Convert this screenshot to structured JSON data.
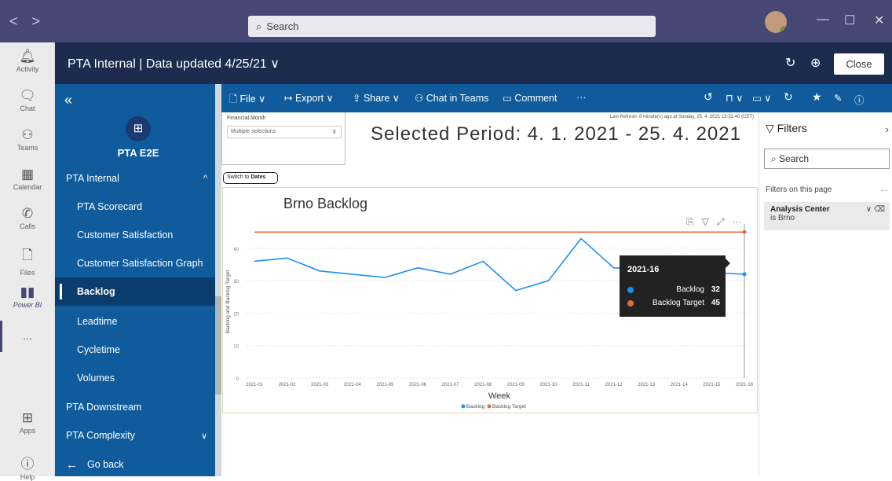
{
  "titlebar": {
    "search_placeholder": "Search",
    "back": "<",
    "forward": ">"
  },
  "rail": [
    {
      "label": "Activity",
      "icon": "bell-icon",
      "glyph": "🔔"
    },
    {
      "label": "Chat",
      "icon": "chat-icon",
      "glyph": "💬"
    },
    {
      "label": "Teams",
      "icon": "teams-icon",
      "glyph": "👥"
    },
    {
      "label": "Calendar",
      "icon": "calendar-icon",
      "glyph": "📅"
    },
    {
      "label": "Calls",
      "icon": "phone-icon",
      "glyph": "📞"
    },
    {
      "label": "Files",
      "icon": "file-icon",
      "glyph": "🗋"
    },
    {
      "label": "Power BI",
      "icon": "powerbi-icon",
      "glyph": "📊"
    },
    {
      "label": "...",
      "icon": "more-icon",
      "glyph": ""
    },
    {
      "label": "Apps",
      "icon": "apps-icon",
      "glyph": "⊞"
    },
    {
      "label": "Help",
      "icon": "help-icon",
      "glyph": "?"
    }
  ],
  "appbar": {
    "title": "PTA Internal | Data updated 4/25/21 ∨",
    "close_label": "Close"
  },
  "leftnav": {
    "workspace": "PTA E2E",
    "items": [
      {
        "label": "PTA Internal",
        "type": "section",
        "chev": "^"
      },
      {
        "label": "PTA Scorecard",
        "type": "sub"
      },
      {
        "label": "Customer Satisfaction",
        "type": "sub"
      },
      {
        "label": "Customer Satisfaction Graph",
        "type": "sub"
      },
      {
        "label": "Backlog",
        "type": "sub",
        "active": true
      },
      {
        "label": "Leadtime",
        "type": "sub"
      },
      {
        "label": "Cycletime",
        "type": "sub"
      },
      {
        "label": "Volumes",
        "type": "sub"
      },
      {
        "label": "PTA Downstream",
        "type": "section"
      },
      {
        "label": "PTA Complexity",
        "type": "section",
        "chev": "∨"
      },
      {
        "label": "Go back",
        "type": "section",
        "prefix": "←"
      }
    ]
  },
  "toolbar": {
    "file": "File ∨",
    "export": "Export ∨",
    "share": "Share ∨",
    "chat": "Chat in Teams",
    "comment": "Comment",
    "more": "···"
  },
  "report": {
    "slicer_label": "Financial Month",
    "slicer_value": "Multiple selections",
    "period": "Selected Period: 4. 1. 2021 - 25. 4. 2021",
    "refresh": "Last Refresh: 8 minute(s) ago at Sunday, 25. 4. 2021 15:31:40 (CET)",
    "switch_prefix": "Switch to ",
    "switch_bold": "Dates"
  },
  "chart_data": {
    "type": "line",
    "title": "Brno Backlog",
    "xlabel": "Week",
    "ylabel": "Backlog and Backlog Target",
    "categories": [
      "2021-01",
      "2021-02",
      "2021-03",
      "2021-04",
      "2021-05",
      "2021-06",
      "2021-07",
      "2021-08",
      "2021-09",
      "2021-10",
      "2021-11",
      "2021-12",
      "2021-13",
      "2021-14",
      "2021-15",
      "2021-16"
    ],
    "series": [
      {
        "name": "Backlog",
        "color": "#1f8ef1",
        "values": [
          36,
          37,
          33,
          32,
          31,
          34,
          32,
          36,
          27,
          30,
          43,
          34,
          null,
          null,
          null,
          32
        ]
      },
      {
        "name": "Backlog Target",
        "color": "#e66c37",
        "values": [
          45,
          45,
          45,
          45,
          45,
          45,
          45,
          45,
          45,
          45,
          45,
          45,
          45,
          45,
          45,
          45
        ]
      }
    ],
    "yticks": [
      0,
      10,
      20,
      30,
      40
    ],
    "ylim": [
      0,
      47
    ],
    "legend": "bottom-center",
    "tooltip": {
      "week": "2021-16",
      "backlog_label": "Backlog",
      "backlog_value": "32",
      "target_label": "Backlog Target",
      "target_value": "45"
    }
  },
  "filters": {
    "title": "Filters",
    "search": "Search",
    "section": "Filters on this page",
    "more": "...",
    "card_title": "Analysis Center",
    "card_sub": "is Brno"
  }
}
